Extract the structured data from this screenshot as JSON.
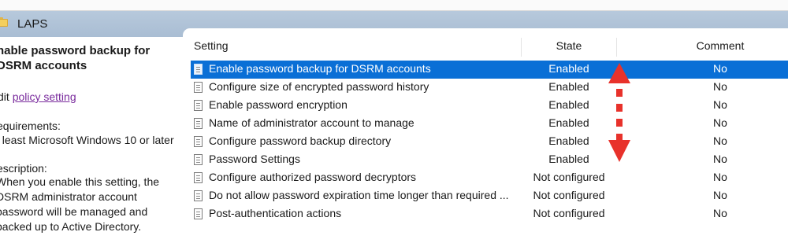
{
  "window": {
    "title": "LAPS"
  },
  "details": {
    "heading": "nable password backup for DSRM accounts",
    "edit_prefix": "dit",
    "edit_link": "policy setting",
    "requirements_label": "equirements:",
    "requirements_text": "t least Microsoft Windows 10 or later",
    "description_label": "escription:",
    "description_text": "When you enable this setting, the DSRM administrator account password will be managed and backed up to Active Directory."
  },
  "table": {
    "columns": {
      "setting": "Setting",
      "state": "State",
      "comment": "Comment"
    },
    "rows": [
      {
        "setting": "Enable password backup for DSRM accounts",
        "state": "Enabled",
        "comment": "No"
      },
      {
        "setting": "Configure size of encrypted password history",
        "state": "Enabled",
        "comment": "No"
      },
      {
        "setting": "Enable password encryption",
        "state": "Enabled",
        "comment": "No"
      },
      {
        "setting": "Name of administrator account to manage",
        "state": "Enabled",
        "comment": "No"
      },
      {
        "setting": "Configure password backup directory",
        "state": "Enabled",
        "comment": "No"
      },
      {
        "setting": "Password Settings",
        "state": "Enabled",
        "comment": "No"
      },
      {
        "setting": "Configure authorized password decryptors",
        "state": "Not configured",
        "comment": "No"
      },
      {
        "setting": "Do not allow password expiration time longer than required ...",
        "state": "Not configured",
        "comment": "No"
      },
      {
        "setting": "Post-authentication actions",
        "state": "Not configured",
        "comment": "No"
      }
    ]
  },
  "colors": {
    "selection": "#0a6fd6",
    "arrow": "#e8322b",
    "link": "#7a2b9d"
  }
}
